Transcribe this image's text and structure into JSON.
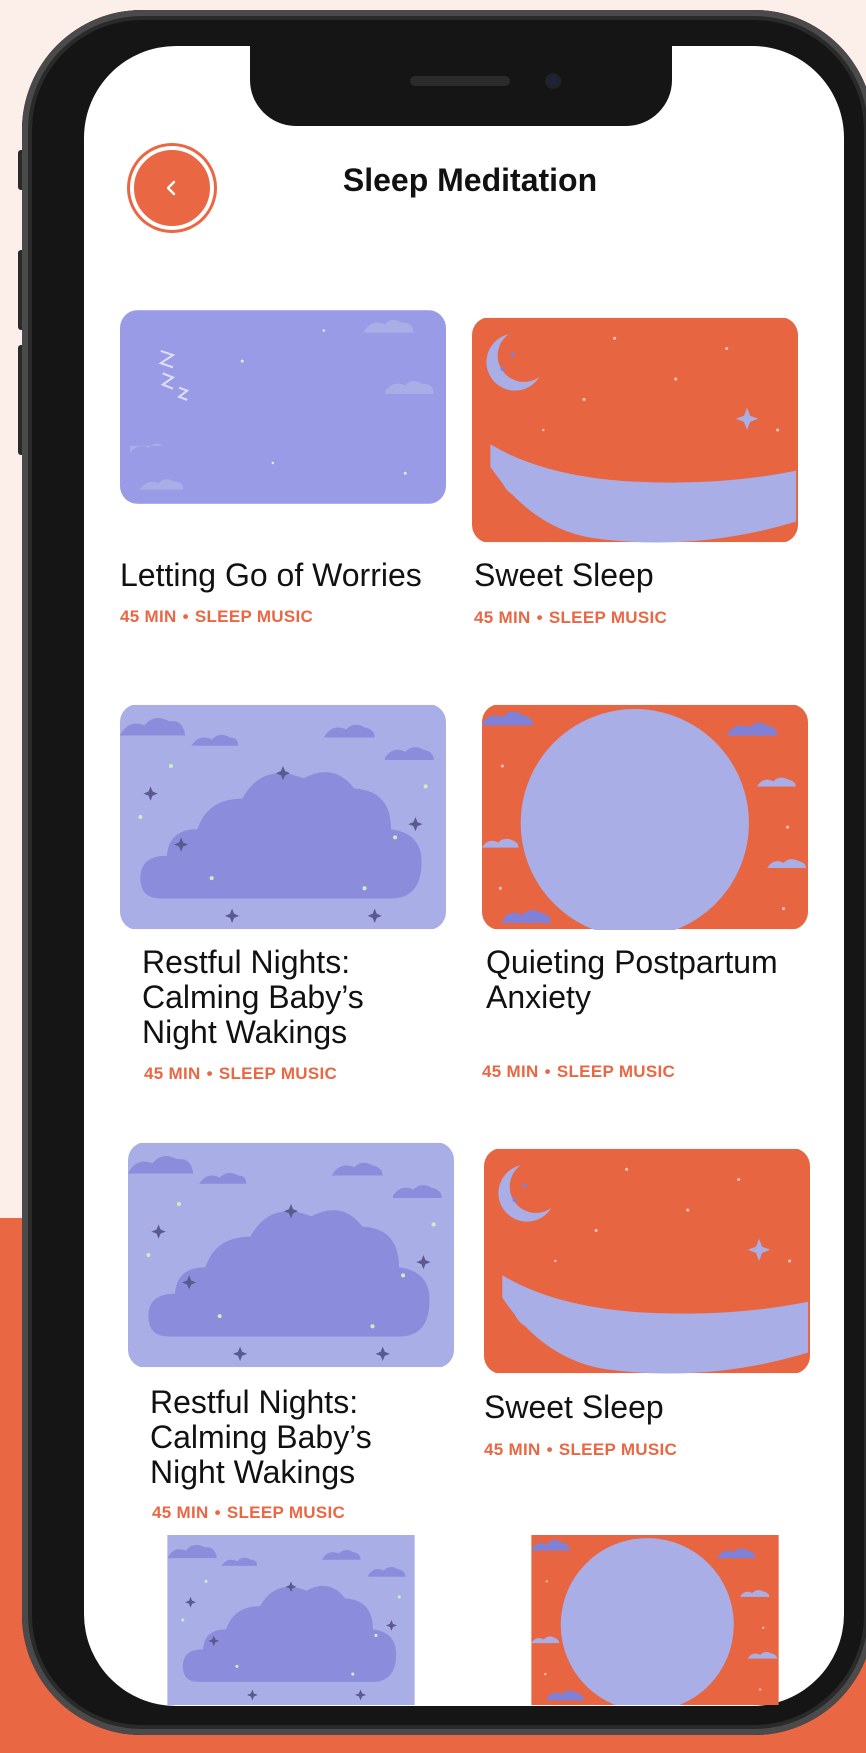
{
  "header": {
    "title": "Sleep Meditation",
    "back_icon": "chevron-left-icon"
  },
  "colors": {
    "accent": "#ea6744",
    "lavender": "#9a9be6",
    "lavender_light": "#a9aee6",
    "cloud": "#7f80d8"
  },
  "cards": [
    {
      "title": "Letting Go of Worries",
      "duration": "45 MIN",
      "category": "SLEEP MUSIC",
      "art": "lavender-zzz"
    },
    {
      "title": "Sweet Sleep",
      "duration": "45 MIN",
      "category": "SLEEP MUSIC",
      "art": "orange-moon-branch"
    },
    {
      "title": "Restful Nights: Calming Baby’s Night Wakings",
      "duration": "45 MIN",
      "category": "SLEEP MUSIC",
      "art": "lavender-cloud"
    },
    {
      "title": "Quieting Postpartum Anxiety",
      "duration": "45 MIN",
      "category": "SLEEP MUSIC",
      "art": "orange-big-moon"
    },
    {
      "title": "Restful Nights: Calming Baby’s Night Wakings",
      "duration": "45 MIN",
      "category": "SLEEP MUSIC",
      "art": "lavender-cloud"
    },
    {
      "title": "Sweet Sleep",
      "duration": "45 MIN",
      "category": "SLEEP MUSIC",
      "art": "orange-moon-branch"
    }
  ]
}
